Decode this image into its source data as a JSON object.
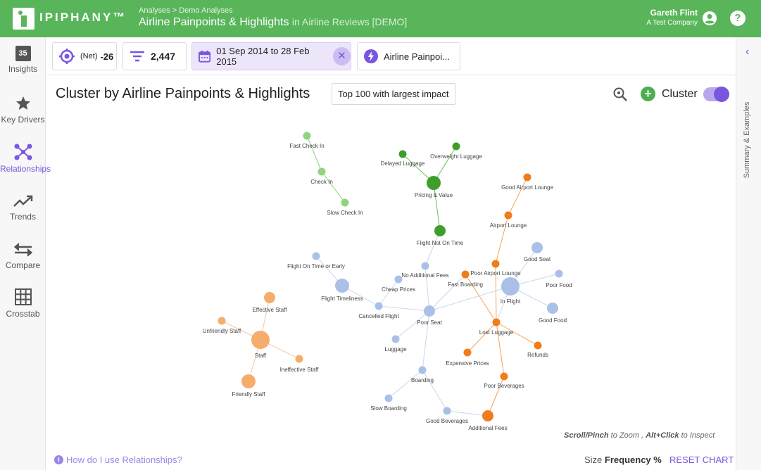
{
  "app": {
    "logo_text": "IPIPHANY™"
  },
  "header": {
    "breadcrumb_root": "Analyses",
    "breadcrumb_sep": ">",
    "breadcrumb_current": "Demo Analyses",
    "title": "Airline Painpoints & Highlights",
    "context": "in Airline Reviews [DEMO]",
    "user_name": "Gareth Flint",
    "user_company": "A Test Company",
    "help": "?"
  },
  "sidebar": {
    "items": [
      {
        "label": "Insights",
        "badge": "35"
      },
      {
        "label": "Key Drivers"
      },
      {
        "label": "Relationships"
      },
      {
        "label": "Trends"
      },
      {
        "label": "Compare"
      },
      {
        "label": "Crosstab"
      }
    ]
  },
  "filters": {
    "net_prefix": "(Net)",
    "net_value": "-26",
    "count": "2,447",
    "date_range": "01 Sep 2014 to 28 Feb 2015",
    "model": "Airline Painpoi..."
  },
  "panel": {
    "title": "Cluster by Airline Painpoints & Highlights",
    "topn": "Top 100 with largest impact",
    "cluster_label": "Cluster",
    "cluster_on": true
  },
  "right_panel": {
    "label": "Summary & Examples"
  },
  "footer": {
    "hint_zoom": "Scroll/Pinch",
    "hint_zoom_rest": " to Zoom , ",
    "hint_inspect": "Alt+Click",
    "hint_inspect_rest": " to Inspect",
    "howto": "How do I use Relationships?",
    "size_prefix": "Size",
    "size_value": "Frequency %",
    "reset": "RESET CHART"
  },
  "colors": {
    "header_green": "#59b55a",
    "accent_purple": "#7a55e0",
    "light_green": "#8fd47f",
    "dark_green": "#3f9e2b",
    "orange": "#f07d1a",
    "light_orange": "#f6ad6b",
    "blue": "#aac0e6"
  },
  "graph": {
    "nodes": [
      {
        "id": "fast-check-in",
        "label": "Fast Check In",
        "group": "lightgreen",
        "size": 1
      },
      {
        "id": "check-in",
        "label": "Check In",
        "group": "lightgreen",
        "size": 1
      },
      {
        "id": "slow-check-in",
        "label": "Slow Check In",
        "group": "lightgreen",
        "size": 1
      },
      {
        "id": "delayed-luggage",
        "label": "Delayed Luggage",
        "group": "darkgreen",
        "size": 1
      },
      {
        "id": "overweight-luggage",
        "label": "Overweight Luggage",
        "group": "darkgreen",
        "size": 1
      },
      {
        "id": "pricing-value",
        "label": "Pricing & Value",
        "group": "darkgreen",
        "size": 3
      },
      {
        "id": "flight-not-on-time",
        "label": "Flight Not On Time",
        "group": "darkgreen",
        "size": 2
      },
      {
        "id": "good-airport-lounge",
        "label": "Good Airport Lounge",
        "group": "orange",
        "size": 1
      },
      {
        "id": "airport-lounge",
        "label": "Airport Lounge",
        "group": "orange",
        "size": 1
      },
      {
        "id": "poor-airport-lounge",
        "label": "Poor Airport Lounge",
        "group": "orange",
        "size": 1
      },
      {
        "id": "fast-boarding",
        "label": "Fast Boarding",
        "group": "orange",
        "size": 1
      },
      {
        "id": "lost-luggage",
        "label": "Lost Luggage",
        "group": "orange",
        "size": 1
      },
      {
        "id": "refunds",
        "label": "Refunds",
        "group": "orange",
        "size": 1
      },
      {
        "id": "expensive-prices",
        "label": "Expensive Prices",
        "group": "orange",
        "size": 1
      },
      {
        "id": "poor-beverages",
        "label": "Poor Beverages",
        "group": "orange",
        "size": 1
      },
      {
        "id": "additional-fees",
        "label": "Additional Fees",
        "group": "orange",
        "size": 2
      },
      {
        "id": "good-seat",
        "label": "Good Seat",
        "group": "blue",
        "size": 2
      },
      {
        "id": "poor-food",
        "label": "Poor Food",
        "group": "blue",
        "size": 1
      },
      {
        "id": "in-flight",
        "label": "In Flight",
        "group": "blue",
        "size": 4
      },
      {
        "id": "good-food",
        "label": "Good Food",
        "group": "blue",
        "size": 2
      },
      {
        "id": "flight-on-time-or-early",
        "label": "Flight On Time or Early",
        "group": "blue",
        "size": 1
      },
      {
        "id": "no-additional-fees",
        "label": "No Additional Fees",
        "group": "blue",
        "size": 1
      },
      {
        "id": "flight-timeliness",
        "label": "Flight Timeliness",
        "group": "blue",
        "size": 3
      },
      {
        "id": "cheap-prices",
        "label": "Cheap Prices",
        "group": "blue",
        "size": 1
      },
      {
        "id": "cancelled-flight",
        "label": "Cancelled Flight",
        "group": "blue",
        "size": 1
      },
      {
        "id": "poor-seat",
        "label": "Poor Seat",
        "group": "blue",
        "size": 2
      },
      {
        "id": "luggage",
        "label": "Luggage",
        "group": "blue",
        "size": 1
      },
      {
        "id": "boarding",
        "label": "Boarding",
        "group": "blue",
        "size": 1
      },
      {
        "id": "slow-boarding",
        "label": "Slow Boarding",
        "group": "blue",
        "size": 1
      },
      {
        "id": "good-beverages",
        "label": "Good Beverages",
        "group": "blue",
        "size": 1
      },
      {
        "id": "effective-staff",
        "label": "Effective Staff",
        "group": "lightorange",
        "size": 2
      },
      {
        "id": "unfriendly-staff",
        "label": "Unfriendly Staff",
        "group": "lightorange",
        "size": 1
      },
      {
        "id": "staff",
        "label": "Staff",
        "group": "lightorange",
        "size": 4
      },
      {
        "id": "ineffective-staff",
        "label": "Ineffective Staff",
        "group": "lightorange",
        "size": 1
      },
      {
        "id": "friendly-staff",
        "label": "Friendly Staff",
        "group": "lightorange",
        "size": 3
      }
    ],
    "edges": [
      [
        "fast-check-in",
        "check-in"
      ],
      [
        "check-in",
        "slow-check-in"
      ],
      [
        "delayed-luggage",
        "pricing-value"
      ],
      [
        "overweight-luggage",
        "pricing-value"
      ],
      [
        "pricing-value",
        "flight-not-on-time"
      ],
      [
        "flight-not-on-time",
        "no-additional-fees"
      ],
      [
        "good-airport-lounge",
        "airport-lounge"
      ],
      [
        "airport-lounge",
        "poor-airport-lounge"
      ],
      [
        "poor-airport-lounge",
        "lost-luggage"
      ],
      [
        "fast-boarding",
        "lost-luggage"
      ],
      [
        "lost-luggage",
        "refunds"
      ],
      [
        "lost-luggage",
        "expensive-prices"
      ],
      [
        "lost-luggage",
        "poor-beverages"
      ],
      [
        "poor-beverages",
        "additional-fees"
      ],
      [
        "additional-fees",
        "good-beverages"
      ],
      [
        "good-beverages",
        "boarding"
      ],
      [
        "boarding",
        "slow-boarding"
      ],
      [
        "boarding",
        "poor-seat"
      ],
      [
        "poor-seat",
        "luggage"
      ],
      [
        "poor-seat",
        "cancelled-flight"
      ],
      [
        "cancelled-flight",
        "cheap-prices"
      ],
      [
        "cancelled-flight",
        "flight-timeliness"
      ],
      [
        "flight-timeliness",
        "flight-on-time-or-early"
      ],
      [
        "poor-seat",
        "no-additional-fees"
      ],
      [
        "poor-seat",
        "in-flight"
      ],
      [
        "poor-seat",
        "fast-boarding"
      ],
      [
        "in-flight",
        "good-seat"
      ],
      [
        "in-flight",
        "poor-food"
      ],
      [
        "in-flight",
        "good-food"
      ],
      [
        "in-flight",
        "lost-luggage"
      ],
      [
        "effective-staff",
        "staff"
      ],
      [
        "unfriendly-staff",
        "staff"
      ],
      [
        "staff",
        "ineffective-staff"
      ],
      [
        "staff",
        "friendly-staff"
      ]
    ]
  }
}
